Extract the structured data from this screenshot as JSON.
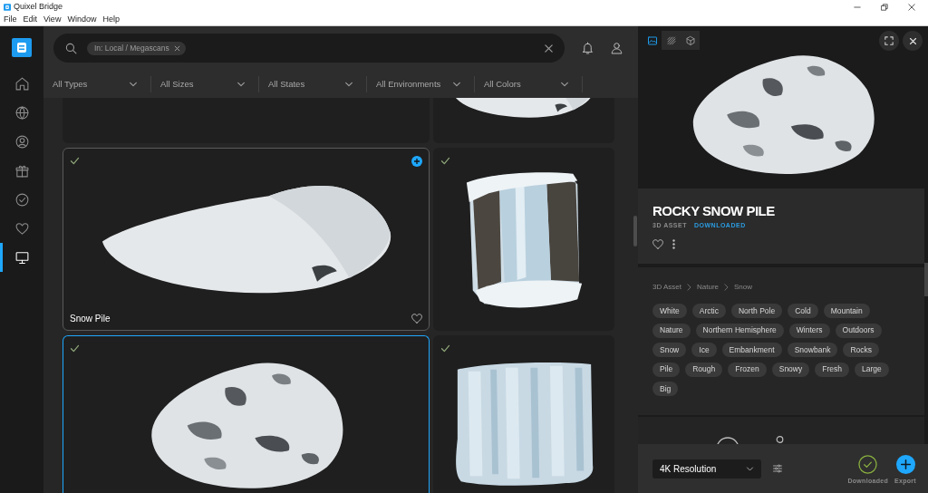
{
  "window": {
    "title": "Quixel Bridge"
  },
  "menu": [
    "File",
    "Edit",
    "View",
    "Window",
    "Help"
  ],
  "sidebar": {
    "items": [
      {
        "kind": "home",
        "selected": false
      },
      {
        "kind": "globe",
        "selected": false
      },
      {
        "kind": "user",
        "selected": false
      },
      {
        "kind": "gift",
        "selected": false
      },
      {
        "kind": "check",
        "selected": false
      },
      {
        "kind": "heart",
        "selected": false
      },
      {
        "kind": "monitor",
        "selected": true
      }
    ]
  },
  "search": {
    "chips": [
      "In: Local / Megascans"
    ]
  },
  "filters": [
    "All Types",
    "All Sizes",
    "All States",
    "All Environments",
    "All Colors"
  ],
  "grid": {
    "partial_row": [
      {
        "kind": "blank"
      },
      {
        "kind": "snow-mound"
      }
    ],
    "rows": [
      [
        {
          "kind": "snow-mound",
          "label": "Snow Pile",
          "downloaded": true,
          "hovered": true,
          "selected": false
        },
        {
          "kind": "ice-cliff",
          "downloaded": true,
          "hovered": false,
          "selected": false
        }
      ],
      [
        {
          "kind": "rocky-mound",
          "downloaded": true,
          "hovered": false,
          "selected": true
        },
        {
          "kind": "ice-block",
          "downloaded": true,
          "hovered": false,
          "selected": false
        }
      ]
    ]
  },
  "detail": {
    "view_tabs": [
      {
        "kind": "image",
        "selected": true
      },
      {
        "kind": "texture",
        "selected": false
      },
      {
        "kind": "model",
        "selected": false
      }
    ],
    "preview": {
      "kind": "rocky-mound"
    },
    "title": "ROCKY SNOW PILE",
    "type": "3D ASSET",
    "status": "DOWNLOADED",
    "breadcrumb": [
      "3D Asset",
      "Nature",
      "Snow"
    ],
    "tags": [
      "White",
      "Arctic",
      "North Pole",
      "Cold",
      "Mountain",
      "Nature",
      "Northern Hemisphere",
      "Winters",
      "Outdoors",
      "Snow",
      "Ice",
      "Embankment",
      "Snowbank",
      "Rocks",
      "Pile",
      "Rough",
      "Frozen",
      "Snowy",
      "Fresh",
      "Large",
      "Big"
    ],
    "resolution": "4K Resolution",
    "actions": [
      {
        "kind": "downloaded",
        "label": "Downloaded"
      },
      {
        "kind": "export",
        "label": "Export"
      }
    ]
  }
}
